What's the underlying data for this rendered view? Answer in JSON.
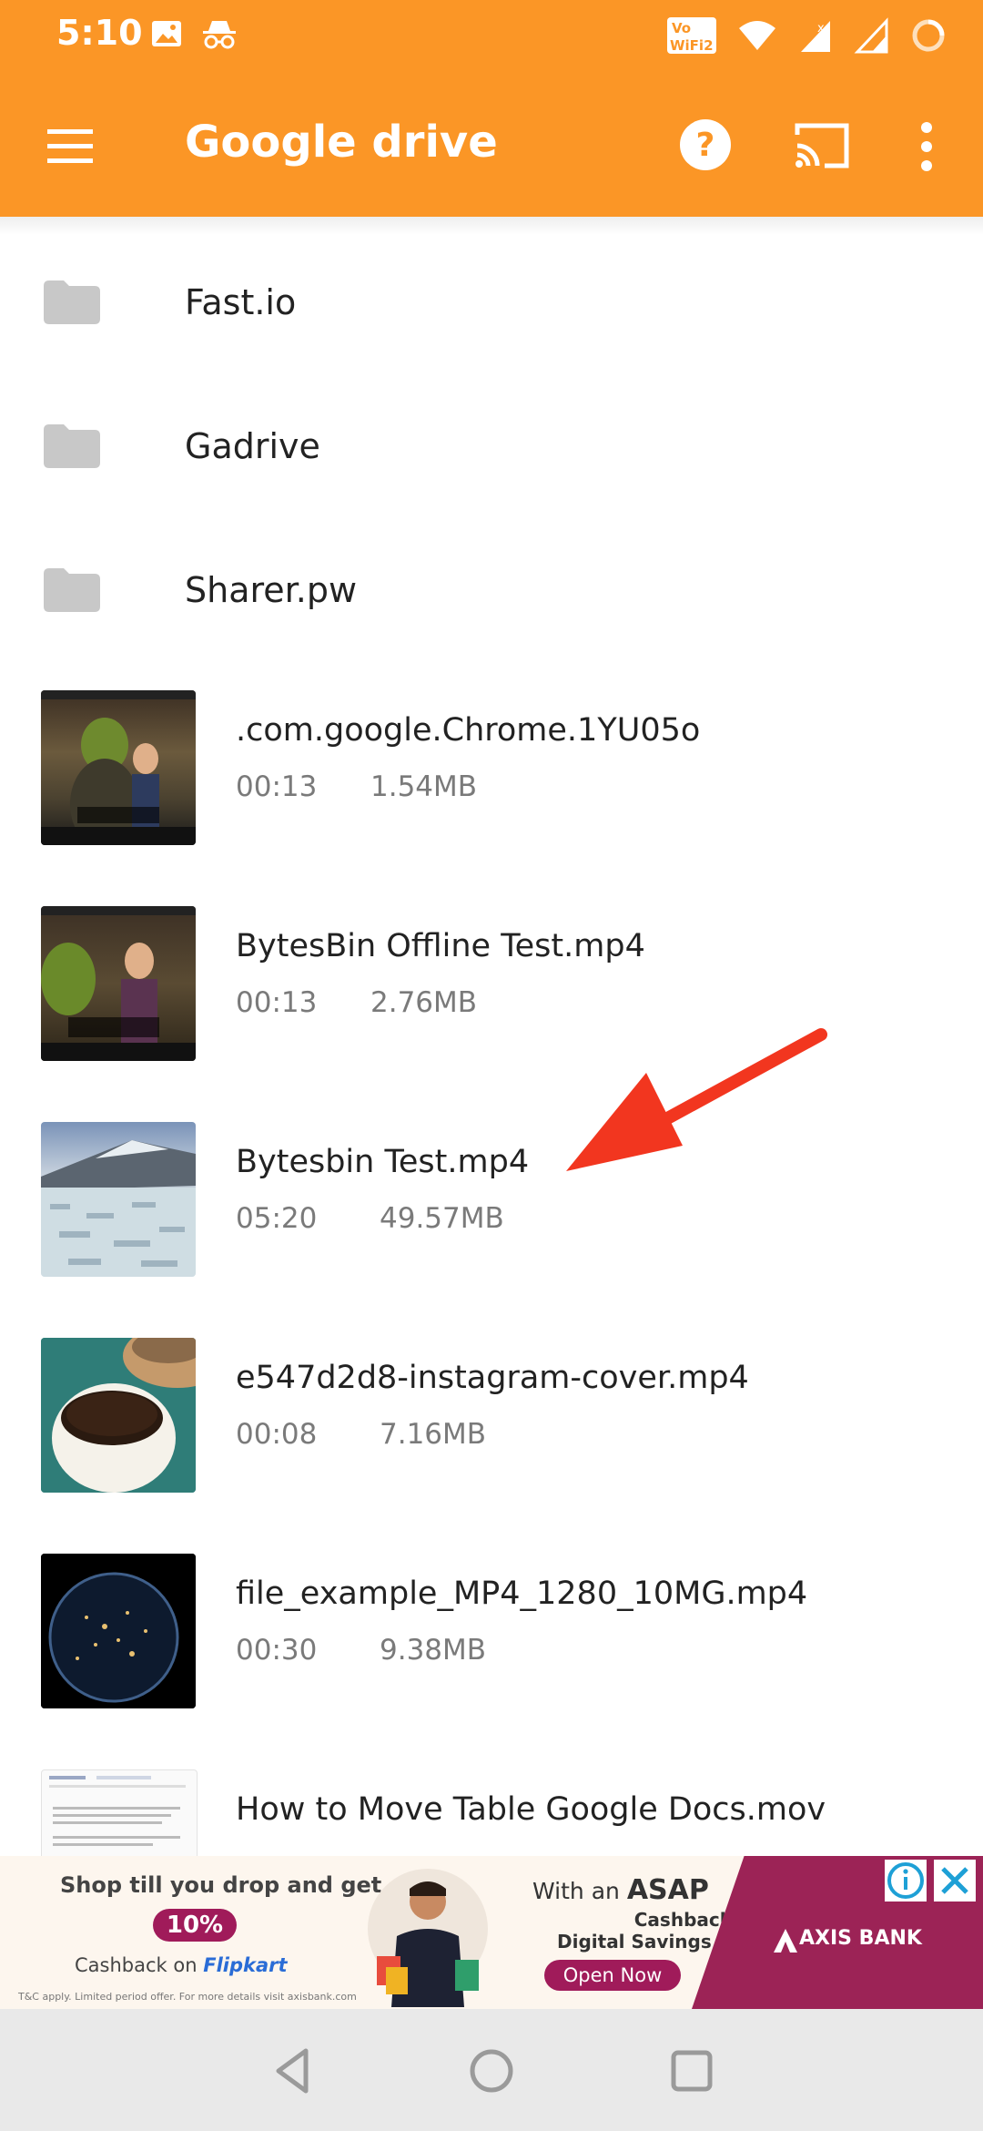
{
  "status_bar": {
    "time": "5:10",
    "icons": [
      "image-icon",
      "incognito-icon",
      "volte-wifi-icon",
      "wifi-icon",
      "signal-icon",
      "signal-r-icon",
      "loading-icon"
    ],
    "vowifi_text": "Vo WiFi 2"
  },
  "app_bar": {
    "title": "Google drive",
    "icons": [
      "menu-icon",
      "help-icon",
      "cast-icon",
      "more-icon"
    ]
  },
  "folders": [
    {
      "name": "Fast.io"
    },
    {
      "name": "Gadrive"
    },
    {
      "name": "Sharer.pw"
    }
  ],
  "files": [
    {
      "name": ".com.google.Chrome.1YU05o",
      "duration": "00:13",
      "size": "1.54MB"
    },
    {
      "name": "BytesBin Offline Test.mp4",
      "duration": "00:13",
      "size": "2.76MB"
    },
    {
      "name": "Bytesbin Test.mp4",
      "duration": "05:20",
      "size": "49.57MB"
    },
    {
      "name": "e547d2d8-instagram-cover.mp4",
      "duration": "00:08",
      "size": "7.16MB"
    },
    {
      "name": "file_example_MP4_1280_10MG.mp4",
      "duration": "00:30",
      "size": "9.38MB"
    },
    {
      "name": "How to Move Table Google Docs.mov",
      "duration": "",
      "size": ""
    }
  ],
  "ad": {
    "line1": "Shop till you drop and get",
    "percent": "10%",
    "line2": "Cashback on",
    "flipkart": "Flipkart",
    "fine_print": "T&C apply. Limited period offer. For more details visit axisbank.com",
    "with_an": "With an",
    "asap": "ASAP",
    "cashback": "Cashback",
    "account": "Digital Savings Account!",
    "open_now": "Open Now",
    "brand": "AXIS BANK"
  },
  "colors": {
    "accent": "#fb9626",
    "arrow": "#f2361f",
    "ad_brand": "#9c2356"
  }
}
